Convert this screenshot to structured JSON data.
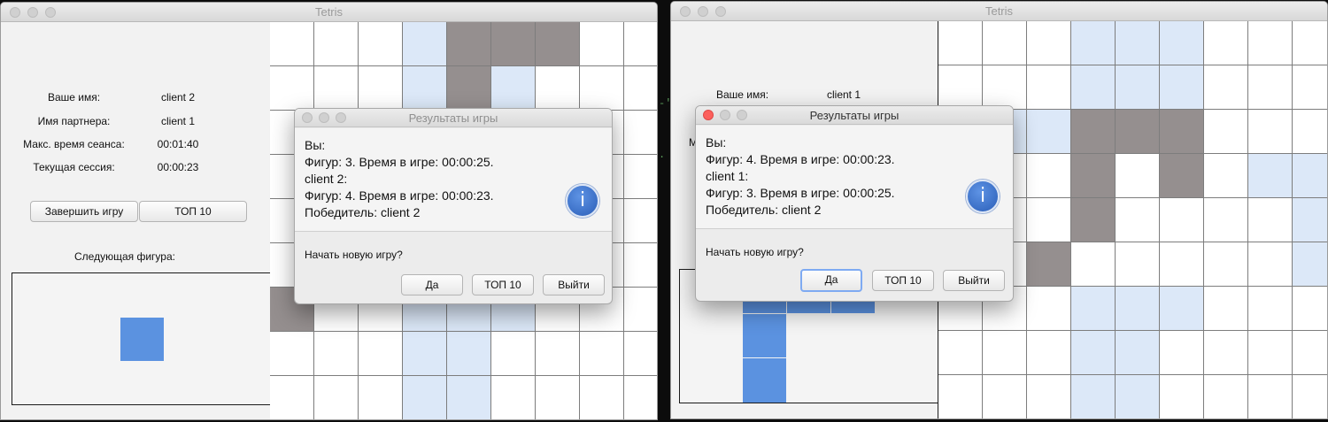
{
  "windows": [
    {
      "title": "Tetris",
      "labels": {
        "your_name": "Ваше имя:",
        "partner_name": "Имя партнера:",
        "max_time": "Макс. время сеанса:",
        "current_session": "Текущая сессия:",
        "next_piece": "Следующая фигура:"
      },
      "values": {
        "your_name": "client 2",
        "partner_name": "client 1",
        "max_time": "00:01:40",
        "current_session": "00:00:23"
      },
      "buttons": {
        "end_game": "Завершить игру",
        "top10": "ТОП 10"
      },
      "board": [
        "...LGGG..",
        "...LGL...",
        ".........",
        ".........",
        ".........",
        ".........",
        "G..LLL...",
        "...LL....",
        "...LL...."
      ],
      "dialog": {
        "title": "Результаты игры",
        "lines": [
          "Вы:",
          "Фигур: 3. Время в игре: 00:00:25.",
          "client 2:",
          "Фигур: 4. Время в игре: 00:00:23.",
          "Победитель: client 2"
        ],
        "question": "Начать новую игру?",
        "buttons": {
          "yes": "Да",
          "top10": "ТОП 10",
          "exit": "Выйти"
        }
      }
    },
    {
      "title": "Tetris",
      "labels": {
        "your_name": "Ваше имя:",
        "partial": "М"
      },
      "values": {
        "your_name": "client 1"
      },
      "board": [
        "...LLL...",
        "...LLL...",
        ".LLGGG...",
        "...G.G.LL",
        "...G....L",
        "..G.....L",
        "...LLL...",
        "...LL....",
        "...LL...."
      ],
      "dialog": {
        "title": "Результаты игры",
        "lines": [
          "Вы:",
          "Фигур: 4. Время в игре: 00:00:23.",
          "client 1:",
          "Фигур: 3. Время в игре: 00:00:25.",
          "Победитель: client 2"
        ],
        "question": "Начать новую игру?",
        "buttons": {
          "yes": "Да",
          "top10": "ТОП 10",
          "exit": "Выйти"
        }
      }
    }
  ],
  "colors": {
    "board_light": "#dce8f8",
    "board_gray": "#958f8f",
    "next_piece": "#5b92e0"
  },
  "icons": [
    "close-light",
    "minimize-light",
    "zoom-light",
    "info-icon"
  ]
}
